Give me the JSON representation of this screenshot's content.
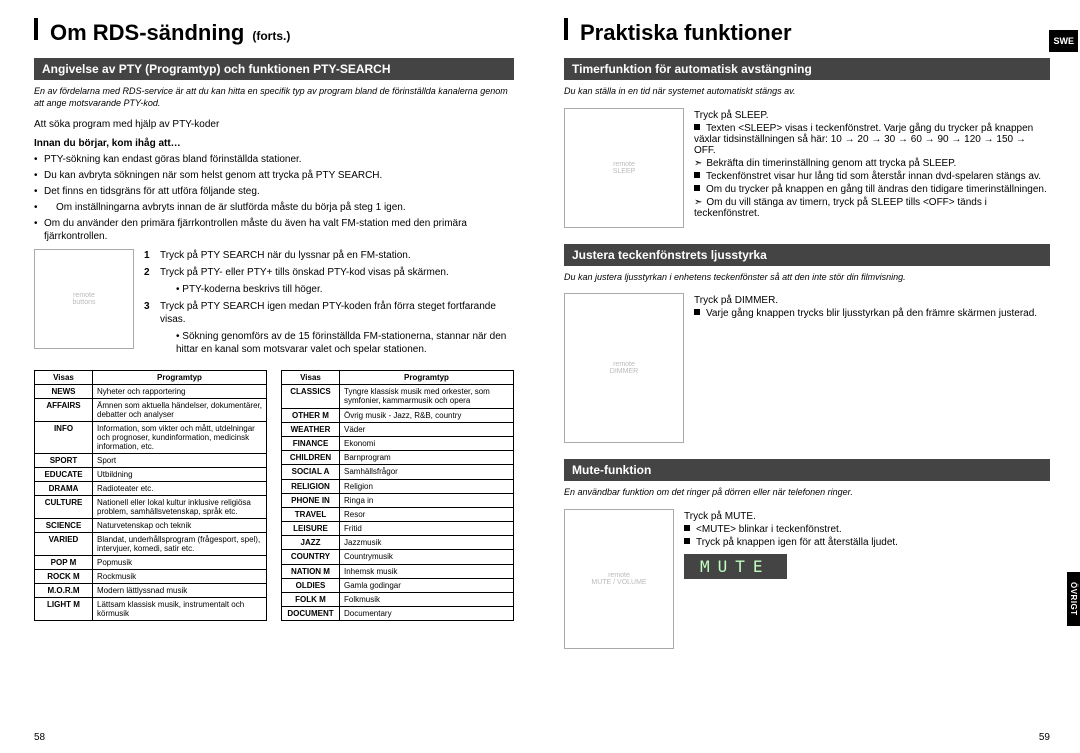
{
  "lang_badge": "SWE",
  "side_tab": "ÖVRIGT",
  "left_page": {
    "title_main": "Om RDS-sändning",
    "title_cont": "(forts.)",
    "section_heading": "Angivelse av PTY (Programtyp) och funktionen PTY-SEARCH",
    "intro": "En av fördelarna med RDS-service är att du kan hitta en specifik typ av program bland de förinställda kanalerna genom att ange motsvarande PTY-kod.",
    "subline": "Att söka program med hjälp av PTY-koder",
    "note_bold": "Innan du börjar, kom ihåg att…",
    "bullets": [
      "PTY-sökning kan endast göras bland förinställda stationer.",
      "Du kan avbryta sökningen när som helst genom att trycka på PTY SEARCH.",
      "Det finns en tidsgräns för att utföra följande steg.",
      "Om inställningarna avbryts innan de är slutförda måste du börja på steg 1 igen.",
      "Om du använder den primära fjärrkontrollen måste du även ha valt FM-station med den primära fjärrkontrollen."
    ],
    "steps": [
      {
        "n": "1",
        "text": "Tryck på PTY SEARCH när du lyssnar på en FM-station."
      },
      {
        "n": "2",
        "text": "Tryck på PTY- eller PTY+ tills önskad PTY-kod visas på skärmen.",
        "sub": "PTY-koderna beskrivs till höger."
      },
      {
        "n": "3",
        "text": "Tryck på PTY SEARCH igen medan PTY-koden från förra steget fortfarande visas.",
        "sub": "Sökning genomförs av de 15 förinställda FM-stationerna, stannar när den hittar en kanal som motsvarar valet och spelar stationen."
      }
    ],
    "table_headers": [
      "Visas",
      "Programtyp"
    ],
    "table_left": [
      [
        "NEWS",
        "Nyheter och rapportering"
      ],
      [
        "AFFAIRS",
        "Ämnen som aktuella händelser, dokumentärer, debatter och analyser"
      ],
      [
        "INFO",
        "Information, som vikter och mått, utdelningar och prognoser, kundinformation, medicinsk information, etc."
      ],
      [
        "SPORT",
        "Sport"
      ],
      [
        "EDUCATE",
        "Utbildning"
      ],
      [
        "DRAMA",
        "Radioteater etc."
      ],
      [
        "CULTURE",
        "Nationell eller lokal kultur inklusive religiösa problem, samhällsvetenskap, språk etc."
      ],
      [
        "SCIENCE",
        "Naturvetenskap och teknik"
      ],
      [
        "VARIED",
        "Blandat, underhållsprogram (frågesport, spel), intervjuer, komedi, satir etc."
      ],
      [
        "POP M",
        "Popmusik"
      ],
      [
        "ROCK M",
        "Rockmusik"
      ],
      [
        "M.O.R.M",
        "Modern lättlyssnad musik"
      ],
      [
        "LIGHT M",
        "Lättsam klassisk musik, instrumentalt och körmusik"
      ]
    ],
    "table_right": [
      [
        "CLASSICS",
        "Tyngre klassisk musik med orkester, som symfonier, kammarmusik och opera"
      ],
      [
        "OTHER M",
        "Övrig musik - Jazz, R&B, country"
      ],
      [
        "WEATHER",
        "Väder"
      ],
      [
        "FINANCE",
        "Ekonomi"
      ],
      [
        "CHILDREN",
        "Barnprogram"
      ],
      [
        "SOCIAL A",
        "Samhällsfrågor"
      ],
      [
        "RELIGION",
        "Religion"
      ],
      [
        "PHONE IN",
        "Ringa in"
      ],
      [
        "TRAVEL",
        "Resor"
      ],
      [
        "LEISURE",
        "Fritid"
      ],
      [
        "JAZZ",
        "Jazzmusik"
      ],
      [
        "COUNTRY",
        "Countrymusik"
      ],
      [
        "NATION M",
        "Inhemsk musik"
      ],
      [
        "OLDIES",
        "Gamla godingar"
      ],
      [
        "FOLK M",
        "Folkmusik"
      ],
      [
        "DOCUMENT",
        "Documentary"
      ]
    ],
    "page_num": "58"
  },
  "right_page": {
    "title_main": "Praktiska funktioner",
    "sections": [
      {
        "heading": "Timerfunktion för automatisk avstängning",
        "intro": "Du kan ställa in en tid när systemet automatiskt stängs av.",
        "action": "Tryck på SLEEP.",
        "detail": "Texten <SLEEP> visas i teckenfönstret. Varje gång du trycker på knappen växlar tidsinställningen så här: 10 → 20 → 30 → 60 → 90 → 120 → 150 → OFF.",
        "arrow1": "Bekräfta din timerinställning genom att trycka på SLEEP.",
        "arrow1_sub": [
          "Teckenfönstret visar hur lång tid som återstår innan dvd-spelaren stängs av.",
          "Om du trycker på knappen en gång till ändras den tidigare timerinställningen."
        ],
        "arrow2": "Om du vill stänga av timern, tryck på SLEEP tills <OFF> tänds i teckenfönstret."
      },
      {
        "heading": "Justera teckenfönstrets ljusstyrka",
        "intro": "Du kan justera ljusstyrkan i enhetens teckenfönster så att den inte stör din filmvisning.",
        "action": "Tryck på DIMMER.",
        "detail": "Varje gång knappen trycks blir ljusstyrkan på den främre skärmen justerad."
      },
      {
        "heading": "Mute-funktion",
        "intro": "En användbar funktion om det ringer på dörren eller när telefonen ringer.",
        "action": "Tryck på MUTE.",
        "detail": "<MUTE> blinkar i teckenfönstret.",
        "detail2": "Tryck på knappen igen för att återställa ljudet.",
        "mute_display": "MUTE"
      }
    ],
    "page_num": "59"
  }
}
